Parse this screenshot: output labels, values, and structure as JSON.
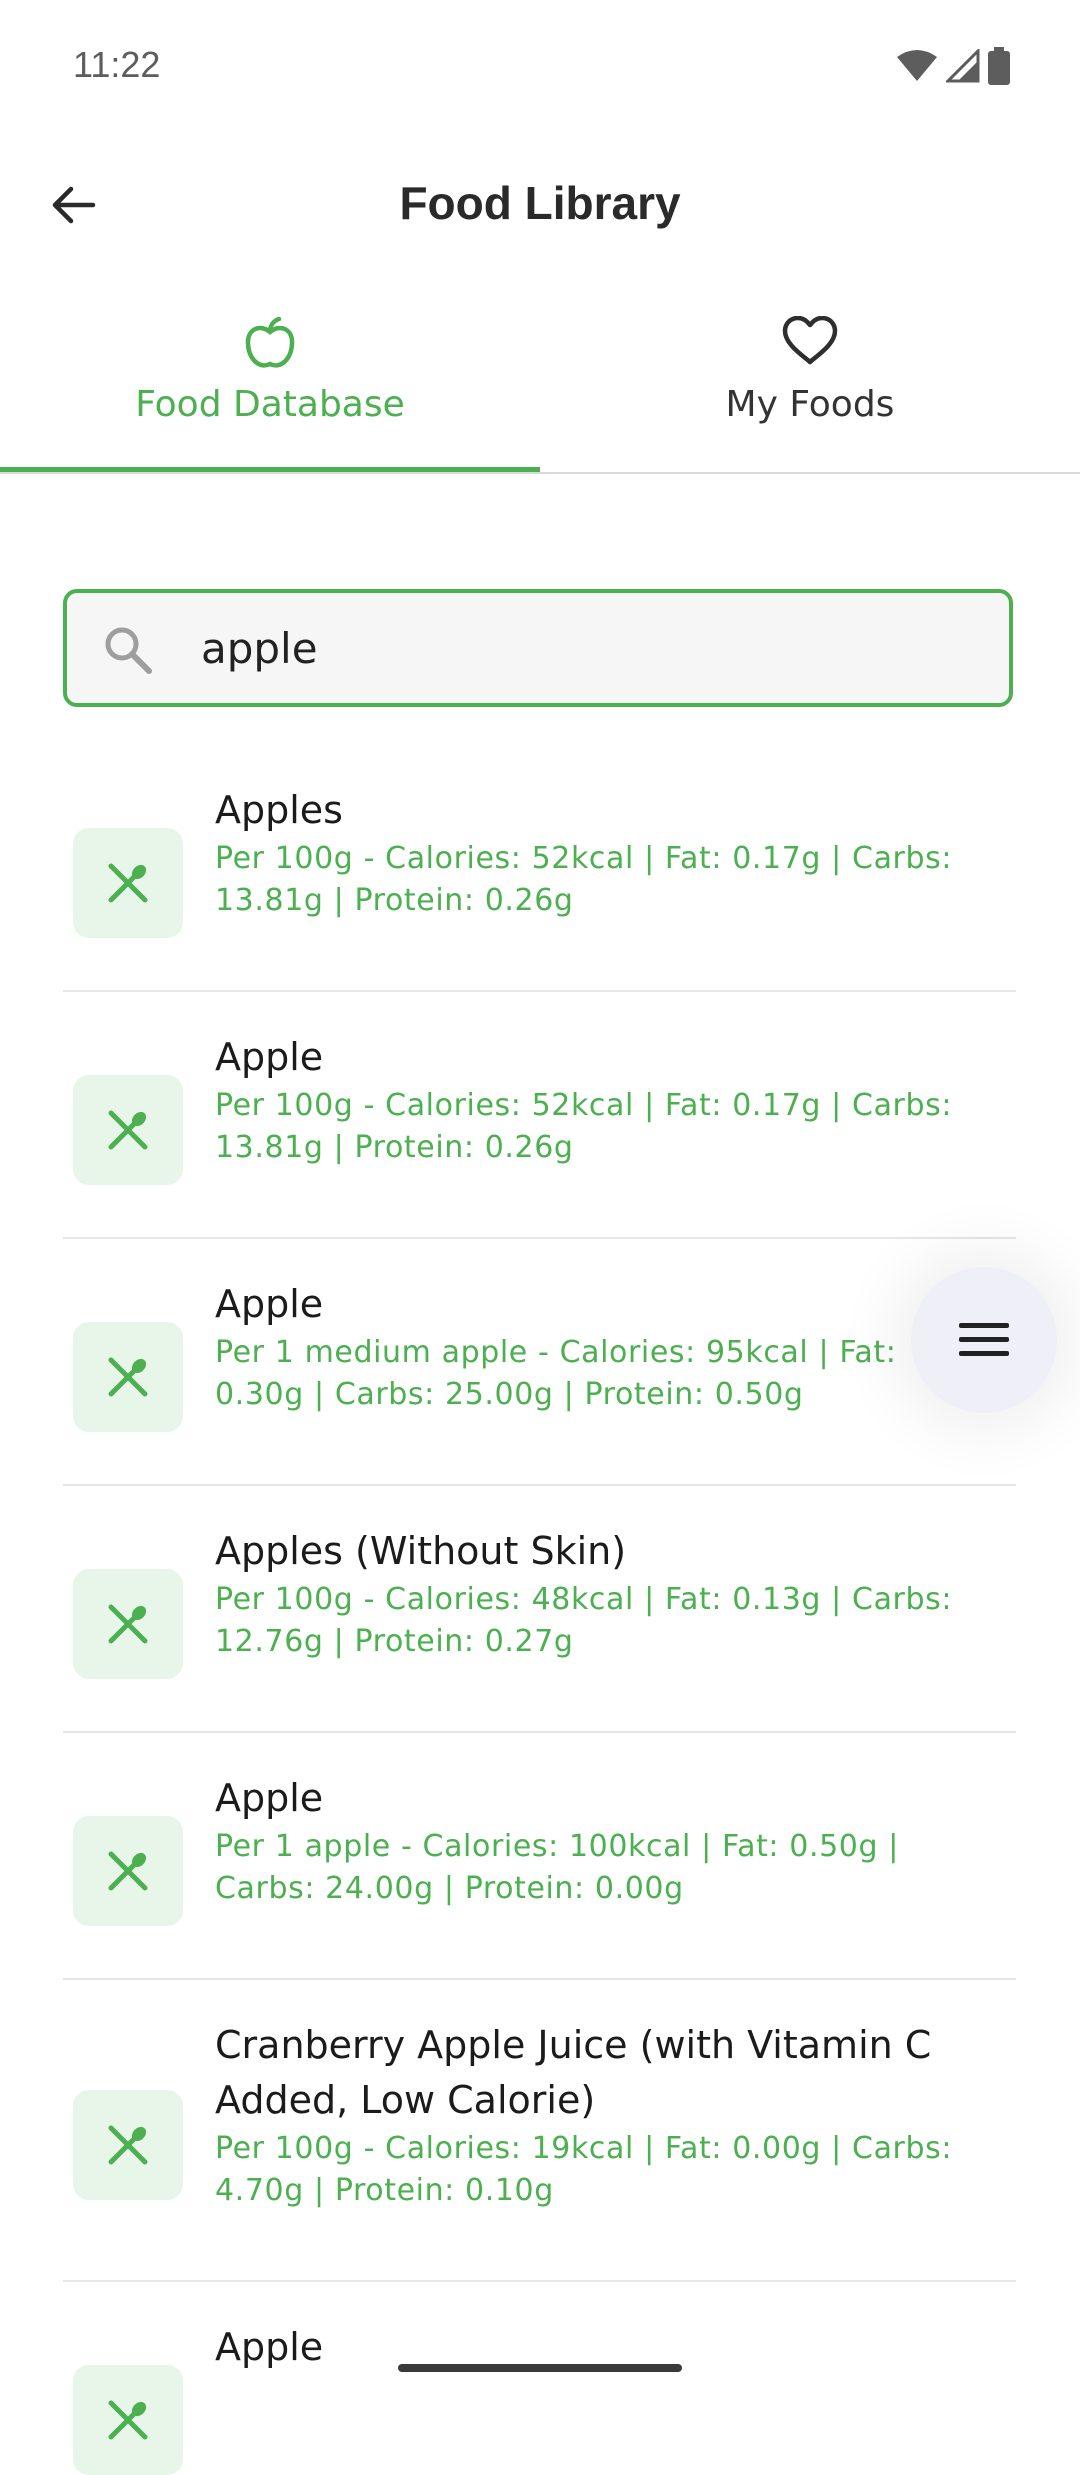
{
  "status_bar": {
    "time": "11:22"
  },
  "app_bar": {
    "title": "Food Library"
  },
  "tabs": [
    {
      "label": "Food Database",
      "icon": "apple-icon",
      "active": true
    },
    {
      "label": "My Foods",
      "icon": "heart-icon",
      "active": false
    }
  ],
  "search": {
    "value": "apple",
    "placeholder": ""
  },
  "results": [
    {
      "name": "Apples",
      "details": "Per 100g - Calories: 52kcal | Fat: 0.17g | Carbs: 13.81g | Protein: 0.26g"
    },
    {
      "name": "Apple",
      "details": "Per 100g - Calories: 52kcal | Fat: 0.17g | Carbs: 13.81g | Protein: 0.26g"
    },
    {
      "name": "Apple",
      "details": "Per 1 medium apple - Calories: 95kcal | Fat: 0.30g | Carbs: 25.00g | Protein: 0.50g"
    },
    {
      "name": "Apples (Without Skin)",
      "details": "Per 100g - Calories: 48kcal | Fat: 0.13g | Carbs: 12.76g | Protein: 0.27g"
    },
    {
      "name": "Apple",
      "details": "Per 1 apple - Calories: 100kcal | Fat: 0.50g | Carbs: 24.00g | Protein: 0.00g"
    },
    {
      "name": "Cranberry Apple Juice (with Vitamin C Added, Low Calorie)",
      "details": "Per 100g - Calories: 19kcal | Fat: 0.00g | Carbs: 4.70g | Protein: 0.10g"
    },
    {
      "name": "Apple",
      "details": ""
    }
  ],
  "colors": {
    "accent": "#4caf50",
    "thumb_bg": "#e8f5e9",
    "fab_bg": "#eeeff7"
  },
  "icons": {
    "row_icon": "fork-spoon-icon",
    "fab_icon": "menu-icon"
  }
}
